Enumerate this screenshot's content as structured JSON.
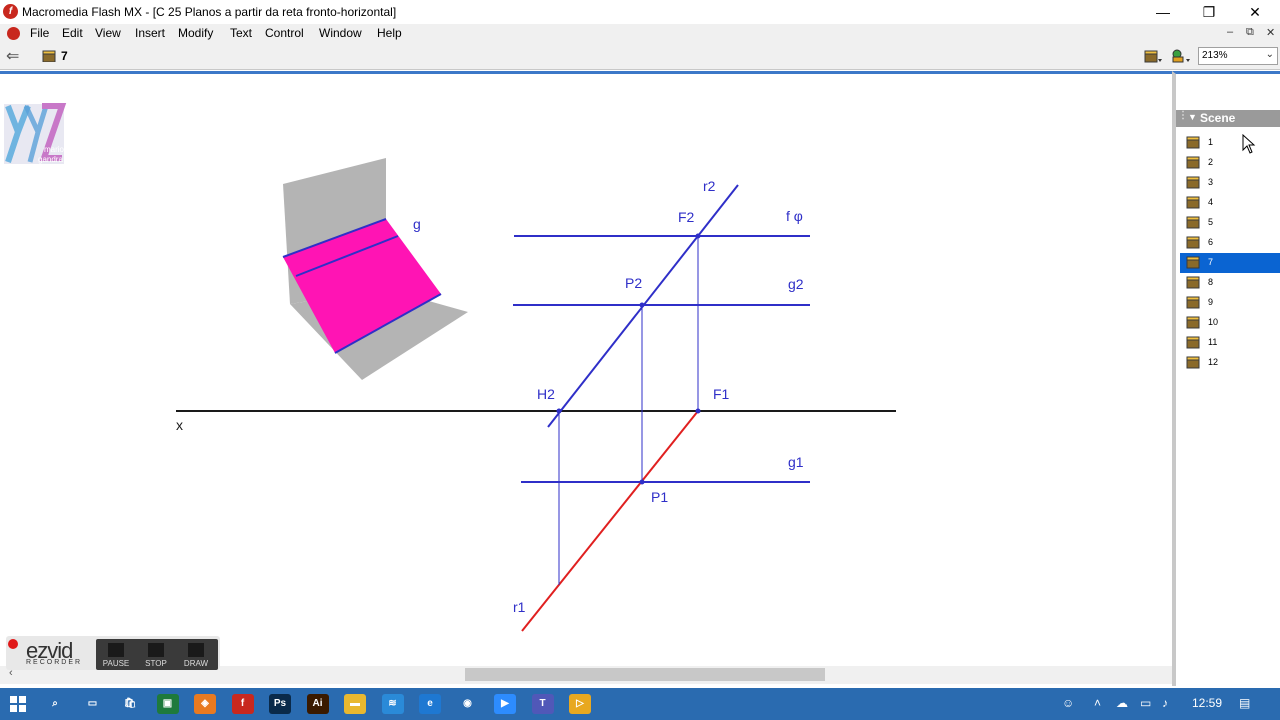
{
  "window": {
    "title": "Macromedia Flash MX - [C 25 Planos a partir da reta fronto-horizontal]",
    "minimize": "—",
    "restore": "❐",
    "close": "✕"
  },
  "menubar": {
    "items": [
      "File",
      "Edit",
      "View",
      "Insert",
      "Modify",
      "Text",
      "Control",
      "Window",
      "Help"
    ],
    "doc_minimize": "–",
    "doc_restore": "⧉",
    "doc_close": "✕"
  },
  "toolbar": {
    "back_icon": "arrow-left-icon",
    "scene_label": "7",
    "zoom_value": "213%"
  },
  "drawing": {
    "labels": {
      "r2": "r2",
      "F2": "F2",
      "f_phi": "f φ",
      "P2": "P2",
      "g2": "g2",
      "H2": "H2",
      "F1": "F1",
      "x": "x",
      "g1": "g1",
      "P1": "P1",
      "r1": "r1",
      "g": "g"
    },
    "watermark_text": [
      "mario",
      "gandra"
    ],
    "colors": {
      "blue": "#2f2fc8",
      "red": "#e02020",
      "magenta": "#ff14b4",
      "gray": "#b4b4b4",
      "black": "#1a1a1a"
    }
  },
  "scene_panel": {
    "header": "Scene",
    "scenes": [
      "1",
      "2",
      "3",
      "4",
      "5",
      "6",
      "7",
      "8",
      "9",
      "10",
      "11",
      "12"
    ],
    "selected_index": 6
  },
  "ezvid": {
    "logo": "ezvid",
    "sub": "RECORDER",
    "buttons": [
      "PAUSE",
      "STOP",
      "DRAW"
    ]
  },
  "taskbar": {
    "apps": [
      {
        "name": "search",
        "glyph": "⌕",
        "color": "#2a6bb0"
      },
      {
        "name": "task-view",
        "glyph": "▭",
        "color": "#2a6bb0"
      },
      {
        "name": "store",
        "glyph": "🛍",
        "color": "#2a6bb0"
      },
      {
        "name": "app-green",
        "glyph": "▣",
        "color": "#1e7a3c"
      },
      {
        "name": "app-orange",
        "glyph": "◈",
        "color": "#e87a20"
      },
      {
        "name": "flash",
        "glyph": "f",
        "color": "#c8281e"
      },
      {
        "name": "photoshop",
        "glyph": "Ps",
        "color": "#0a2a4a"
      },
      {
        "name": "illustrator",
        "glyph": "Ai",
        "color": "#3a1a00"
      },
      {
        "name": "file-explorer",
        "glyph": "▬",
        "color": "#e8b830"
      },
      {
        "name": "app-blue",
        "glyph": "≋",
        "color": "#2a8ad8"
      },
      {
        "name": "edge",
        "glyph": "e",
        "color": "#1e78d2"
      },
      {
        "name": "chrome",
        "glyph": "◉",
        "color": "#2a6bb0"
      },
      {
        "name": "zoom",
        "glyph": "▶",
        "color": "#2d8cff"
      },
      {
        "name": "teams",
        "glyph": "T",
        "color": "#5058b8"
      },
      {
        "name": "media",
        "glyph": "▷",
        "color": "#e8a820"
      }
    ],
    "clock": "12:59"
  }
}
